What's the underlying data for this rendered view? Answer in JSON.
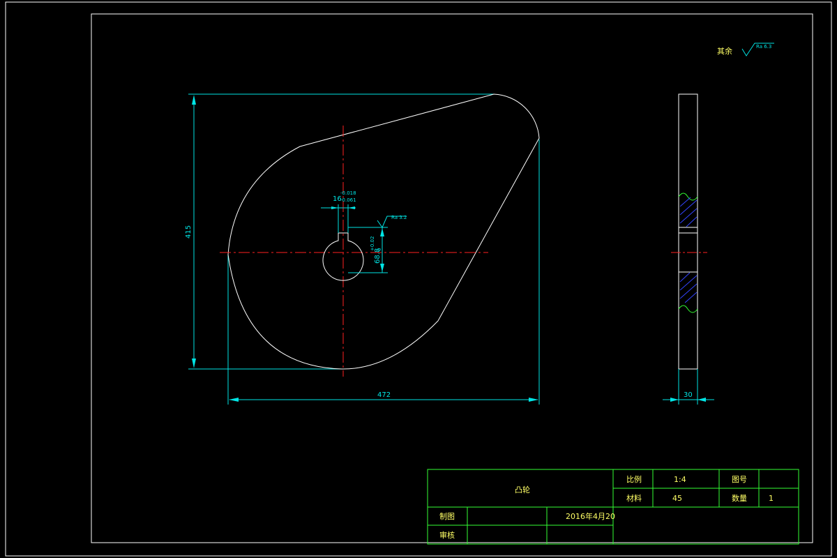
{
  "colors": {
    "background": "#000000",
    "outline": "#ffffff",
    "dimension": "#00e5e5",
    "centerline": "#ff2020",
    "title_block": "#33ff33",
    "hatch": "#3344ff",
    "text": "#ffff66"
  },
  "surface_note": {
    "label": "其余",
    "roughness": "Ra 6.3"
  },
  "front_view": {
    "height_dim": "415",
    "width_dim": "472",
    "keyway_width": "16",
    "keyway_tol_upper": "-0.018",
    "keyway_tol_lower": "-0.061",
    "bore_dim": "68.8",
    "bore_tol_upper": "+0.02",
    "bore_tol_lower": "0",
    "keyway_roughness": "Ra 3.2"
  },
  "side_view": {
    "thickness_dim": "30"
  },
  "title_block": {
    "part_name": "凸轮",
    "scale_label": "比例",
    "scale_value": "1:4",
    "drawing_no_label": "图号",
    "drawing_no_value": "",
    "material_label": "材料",
    "material_value": "45",
    "quantity_label": "数量",
    "quantity_value": "1",
    "drawn_label": "制图",
    "drawn_name": "",
    "date": "2016年4月20",
    "checked_label": "审核",
    "checked_name": ""
  }
}
